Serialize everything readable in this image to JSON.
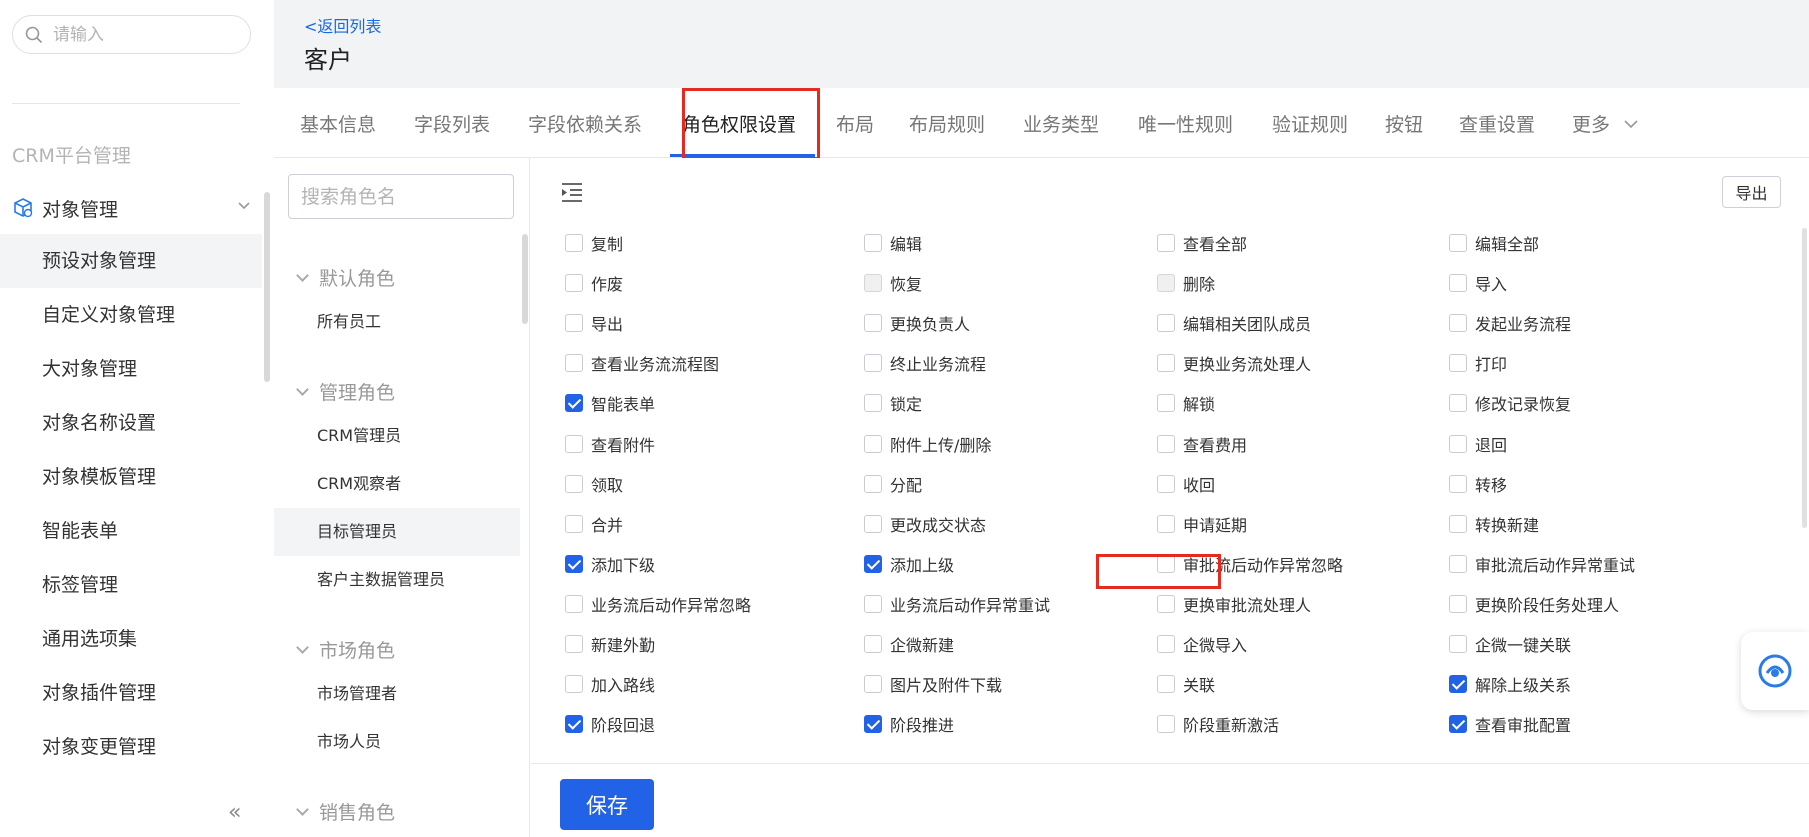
{
  "sidebar": {
    "search_placeholder": "请输入",
    "section_title": "CRM平台管理",
    "group_label": "对象管理",
    "items": [
      {
        "label": "预设对象管理"
      },
      {
        "label": "自定义对象管理"
      },
      {
        "label": "大对象管理"
      },
      {
        "label": "对象名称设置"
      },
      {
        "label": "对象模板管理"
      },
      {
        "label": "智能表单"
      },
      {
        "label": "标签管理"
      },
      {
        "label": "通用选项集"
      },
      {
        "label": "对象插件管理"
      },
      {
        "label": "对象变更管理"
      }
    ],
    "collapse_glyph": "«"
  },
  "header": {
    "back_link": "<返回列表",
    "title": "客户"
  },
  "tabs": [
    {
      "label": "基本信息"
    },
    {
      "label": "字段列表"
    },
    {
      "label": "字段依赖关系"
    },
    {
      "label": "角色权限设置"
    },
    {
      "label": "布局"
    },
    {
      "label": "布局规则"
    },
    {
      "label": "业务类型"
    },
    {
      "label": "唯一性规则"
    },
    {
      "label": "验证规则"
    },
    {
      "label": "按钮"
    },
    {
      "label": "查重设置"
    },
    {
      "label": "更多"
    }
  ],
  "roles": {
    "search_placeholder": "搜索角色名",
    "groups": [
      {
        "label": "默认角色",
        "items": [
          "所有员工"
        ]
      },
      {
        "label": "管理角色",
        "items": [
          "CRM管理员",
          "CRM观察者",
          "目标管理员",
          "客户主数据管理员"
        ]
      },
      {
        "label": "市场角色",
        "items": [
          "市场管理者",
          "市场人员"
        ]
      },
      {
        "label": "销售角色",
        "items": []
      }
    ]
  },
  "permissions": {
    "export_label": "导出",
    "items": [
      {
        "label": "复制",
        "state": "unchecked"
      },
      {
        "label": "编辑",
        "state": "unchecked"
      },
      {
        "label": "查看全部",
        "state": "unchecked"
      },
      {
        "label": "编辑全部",
        "state": "unchecked"
      },
      {
        "label": "作废",
        "state": "unchecked"
      },
      {
        "label": "恢复",
        "state": "disabled"
      },
      {
        "label": "删除",
        "state": "disabled"
      },
      {
        "label": "导入",
        "state": "unchecked"
      },
      {
        "label": "导出",
        "state": "unchecked"
      },
      {
        "label": "更换负责人",
        "state": "unchecked"
      },
      {
        "label": "编辑相关团队成员",
        "state": "unchecked"
      },
      {
        "label": "发起业务流程",
        "state": "unchecked"
      },
      {
        "label": "查看业务流流程图",
        "state": "unchecked"
      },
      {
        "label": "终止业务流程",
        "state": "unchecked"
      },
      {
        "label": "更换业务流处理人",
        "state": "unchecked"
      },
      {
        "label": "打印",
        "state": "unchecked"
      },
      {
        "label": "智能表单",
        "state": "checked"
      },
      {
        "label": "锁定",
        "state": "unchecked"
      },
      {
        "label": "解锁",
        "state": "unchecked"
      },
      {
        "label": "修改记录恢复",
        "state": "unchecked"
      },
      {
        "label": "查看附件",
        "state": "unchecked"
      },
      {
        "label": "附件上传/删除",
        "state": "unchecked"
      },
      {
        "label": "查看费用",
        "state": "unchecked"
      },
      {
        "label": "退回",
        "state": "unchecked"
      },
      {
        "label": "领取",
        "state": "unchecked"
      },
      {
        "label": "分配",
        "state": "unchecked"
      },
      {
        "label": "收回",
        "state": "unchecked"
      },
      {
        "label": "转移",
        "state": "unchecked"
      },
      {
        "label": "合并",
        "state": "unchecked"
      },
      {
        "label": "更改成交状态",
        "state": "unchecked"
      },
      {
        "label": "申请延期",
        "state": "unchecked"
      },
      {
        "label": "转换新建",
        "state": "unchecked"
      },
      {
        "label": "添加下级",
        "state": "checked"
      },
      {
        "label": "添加上级",
        "state": "checked"
      },
      {
        "label": "审批流后动作异常忽略",
        "state": "unchecked"
      },
      {
        "label": "审批流后动作异常重试",
        "state": "unchecked"
      },
      {
        "label": "业务流后动作异常忽略",
        "state": "unchecked"
      },
      {
        "label": "业务流后动作异常重试",
        "state": "unchecked"
      },
      {
        "label": "更换审批流处理人",
        "state": "unchecked"
      },
      {
        "label": "更换阶段任务处理人",
        "state": "unchecked"
      },
      {
        "label": "新建外勤",
        "state": "unchecked"
      },
      {
        "label": "企微新建",
        "state": "unchecked"
      },
      {
        "label": "企微导入",
        "state": "unchecked"
      },
      {
        "label": "企微一键关联",
        "state": "unchecked"
      },
      {
        "label": "加入路线",
        "state": "unchecked"
      },
      {
        "label": "图片及附件下载",
        "state": "unchecked"
      },
      {
        "label": "关联",
        "state": "unchecked"
      },
      {
        "label": "解除上级关系",
        "state": "checked"
      },
      {
        "label": "阶段回退",
        "state": "checked"
      },
      {
        "label": "阶段推进",
        "state": "checked"
      },
      {
        "label": "阶段重新激活",
        "state": "unchecked"
      },
      {
        "label": "查看审批配置",
        "state": "checked"
      }
    ]
  },
  "footer": {
    "save_label": "保存"
  },
  "colors": {
    "primary": "#2262e6",
    "highlight_red": "#e52a1f",
    "header_bg": "#f2f3f5"
  }
}
